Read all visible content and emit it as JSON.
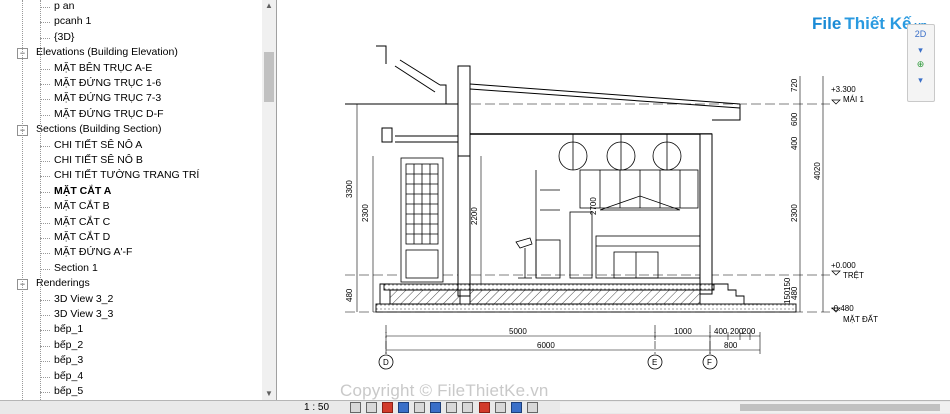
{
  "project_browser": {
    "items": [
      {
        "label": "p an",
        "level": 3,
        "expander": ""
      },
      {
        "label": "pcanh 1",
        "level": 3,
        "expander": ""
      },
      {
        "label": "{3D}",
        "level": 3,
        "expander": ""
      },
      {
        "label": "Elevations (Building Elevation)",
        "level": 2,
        "expander": "−"
      },
      {
        "label": "MẶT BÊN TRỤC A-E",
        "level": 3,
        "expander": ""
      },
      {
        "label": "MẶT ĐỨNG TRỤC 1-6",
        "level": 3,
        "expander": ""
      },
      {
        "label": "MẶT ĐỨNG TRỤC 7-3",
        "level": 3,
        "expander": ""
      },
      {
        "label": "MẶT ĐỨNG TRỤC D-F",
        "level": 3,
        "expander": ""
      },
      {
        "label": "Sections (Building Section)",
        "level": 2,
        "expander": "−"
      },
      {
        "label": "CHI TIẾT SÊ NÔ A",
        "level": 3,
        "expander": ""
      },
      {
        "label": "CHI TIẾT SÊ NÔ B",
        "level": 3,
        "expander": ""
      },
      {
        "label": "CHI TIẾT TƯỜNG TRANG TRÍ",
        "level": 3,
        "expander": ""
      },
      {
        "label": "MẶT CẮT A",
        "level": 3,
        "expander": "",
        "selected": true
      },
      {
        "label": "MẶT CẮT B",
        "level": 3,
        "expander": ""
      },
      {
        "label": "MẶT CẮT C",
        "level": 3,
        "expander": ""
      },
      {
        "label": "MẶT CẮT D",
        "level": 3,
        "expander": ""
      },
      {
        "label": "MẶT ĐỨNG A'-F",
        "level": 3,
        "expander": ""
      },
      {
        "label": "Section 1",
        "level": 3,
        "expander": ""
      },
      {
        "label": "Renderings",
        "level": 2,
        "expander": "−"
      },
      {
        "label": "3D View 3_2",
        "level": 3,
        "expander": ""
      },
      {
        "label": "3D View 3_3",
        "level": 3,
        "expander": ""
      },
      {
        "label": "bếp_1",
        "level": 3,
        "expander": ""
      },
      {
        "label": "bếp_2",
        "level": 3,
        "expander": ""
      },
      {
        "label": "bếp_3",
        "level": 3,
        "expander": ""
      },
      {
        "label": "bếp_4",
        "level": 3,
        "expander": ""
      },
      {
        "label": "bếp_5",
        "level": 3,
        "expander": ""
      }
    ]
  },
  "status_bar": {
    "scale": "1 : 50"
  },
  "logo": {
    "text_file": "File",
    "text_brand": "Thiết Kế",
    "text_vn": ".vn"
  },
  "watermark": "Copyright © FileThietKe.vn",
  "navbar": {
    "view_label": "2D"
  },
  "drawing": {
    "levels": {
      "mai": {
        "elev": "+3.300",
        "name": "MÁI 1"
      },
      "tret": {
        "elev": "+0.000",
        "name": "TRỆT"
      },
      "mat_dat": {
        "elev": "-0.480",
        "name": "MẶT ĐẤT"
      }
    },
    "grid_labels": [
      "D",
      "E",
      "F"
    ],
    "bottom_dims": {
      "row1": [
        "5000",
        "1000",
        "400",
        "200",
        "200"
      ],
      "row2": [
        "6000",
        "800"
      ]
    },
    "left_dims": [
      "3300",
      "2300",
      "480"
    ],
    "inner_dims": [
      "2300",
      "2200",
      "2700",
      "480"
    ],
    "right_dims_inner": [
      "720",
      "600",
      "400",
      "2300",
      "480",
      "150",
      "150"
    ],
    "right_dims_outer": [
      "4020"
    ]
  }
}
